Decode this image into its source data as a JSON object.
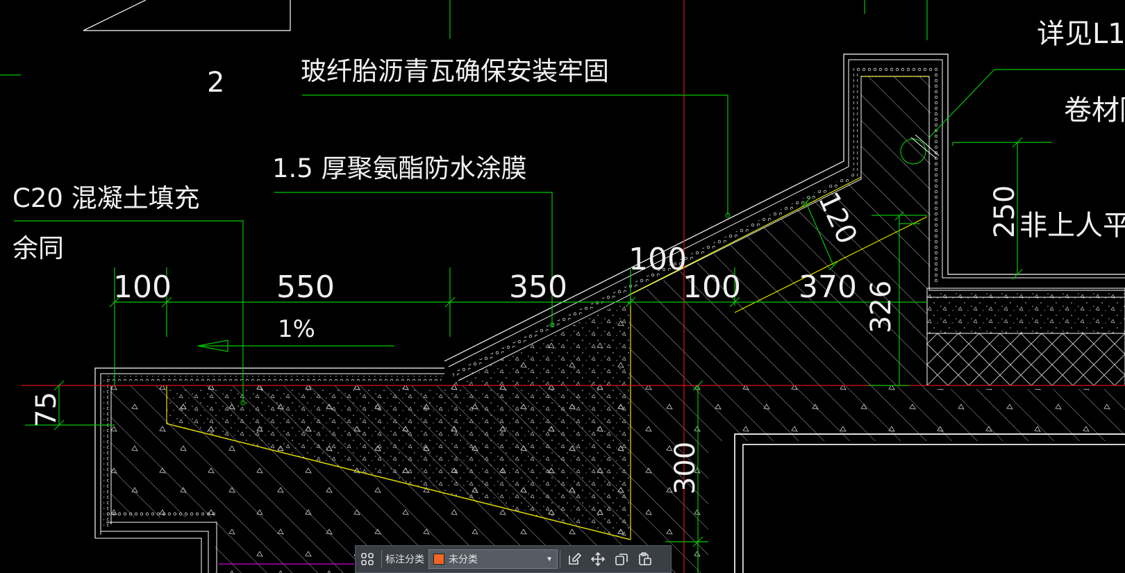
{
  "drawing": {
    "notes": {
      "tile": "玻纤胎沥青瓦确保安装牢固",
      "membrane": "1.5 厚聚氨酯防水涂膜",
      "concrete_line1": "C20 混凝土填充",
      "concrete_line2": "余同",
      "detail_ref": "详见L1",
      "roll": "卷材防",
      "roof": "非上人平屋",
      "label_2": "2"
    },
    "dimensions": {
      "d100_left": "100",
      "d550": "550",
      "d350": "350",
      "d100_slope": "100",
      "d100_mid": "100",
      "d370": "370",
      "d120": "120",
      "d326": "326",
      "d250": "250",
      "d75": "75",
      "d300": "300",
      "slope": "1%"
    },
    "colors": {
      "background": "#000000",
      "leader": "#00c800",
      "axis": "#e01010",
      "outline": "#ffffff",
      "edge": "#e6e600",
      "hatch": "#c8c8c8",
      "text": "#f0f0f0"
    }
  },
  "toolbar": {
    "label": "标注分类",
    "category": "未分类",
    "category_color": "#f26522",
    "icons": [
      "grid-icon",
      "edit-icon",
      "move-icon",
      "copy-icon",
      "paste-icon"
    ]
  }
}
